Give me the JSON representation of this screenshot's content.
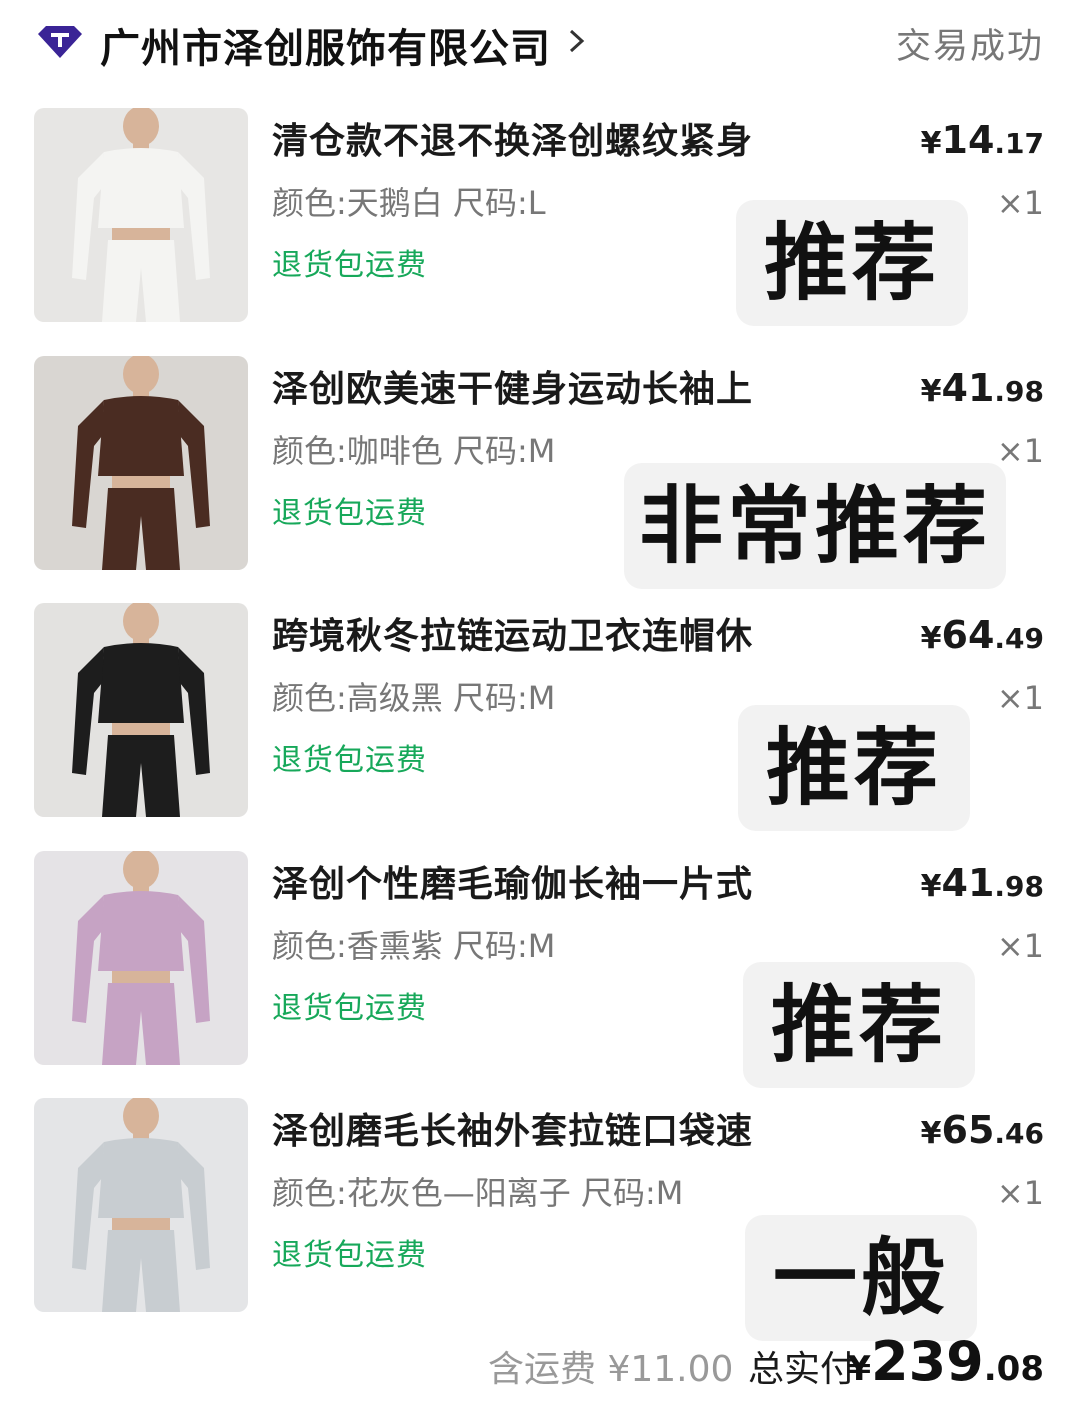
{
  "header": {
    "store_name": "广州市泽创服饰有限公司",
    "status": "交易成功",
    "logo_icon": "diamond-store-icon",
    "chevron_icon": "chevron-right-icon"
  },
  "items": [
    {
      "title": "清仓款不退不换泽创螺纹紧身",
      "spec": "颜色:天鹅白 尺码:L",
      "return_tag": "退货包运费",
      "price_currency": "¥",
      "price_int": "14",
      "price_dec": ".17",
      "qty": "×1",
      "rating": "推荐",
      "garment_color": "#f4f4f2"
    },
    {
      "title": "泽创欧美速干健身运动长袖上",
      "spec": "颜色:咖啡色 尺码:M",
      "return_tag": "退货包运费",
      "price_currency": "¥",
      "price_int": "41",
      "price_dec": ".98",
      "qty": "×1",
      "rating": "非常推荐",
      "garment_color": "#4a2c22"
    },
    {
      "title": "跨境秋冬拉链运动卫衣连帽休",
      "spec": "颜色:高级黑 尺码:M",
      "return_tag": "退货包运费",
      "price_currency": "¥",
      "price_int": "64",
      "price_dec": ".49",
      "qty": "×1",
      "rating": "推荐",
      "garment_color": "#1d1d1d"
    },
    {
      "title": "泽创个性磨毛瑜伽长袖一片式",
      "spec": "颜色:香熏紫 尺码:M",
      "return_tag": "退货包运费",
      "price_currency": "¥",
      "price_int": "41",
      "price_dec": ".98",
      "qty": "×1",
      "rating": "推荐",
      "garment_color": "#c6a3c4"
    },
    {
      "title": "泽创磨毛长袖外套拉链口袋速",
      "spec": "颜色:花灰色—阳离子 尺码:M",
      "return_tag": "退货包运费",
      "price_currency": "¥",
      "price_int": "65",
      "price_dec": ".46",
      "qty": "×1",
      "rating": "一般",
      "garment_color": "#c8cdd1"
    }
  ],
  "footer": {
    "shipping_label": "含运费 ¥11.00",
    "total_label": "总实付",
    "total_currency": "¥",
    "total_int": "239",
    "total_dec": ".08"
  },
  "colors": {
    "return_tag": "#17a85a",
    "logo": "#2b1a7a",
    "rating_bg": "#f2f2f2"
  }
}
